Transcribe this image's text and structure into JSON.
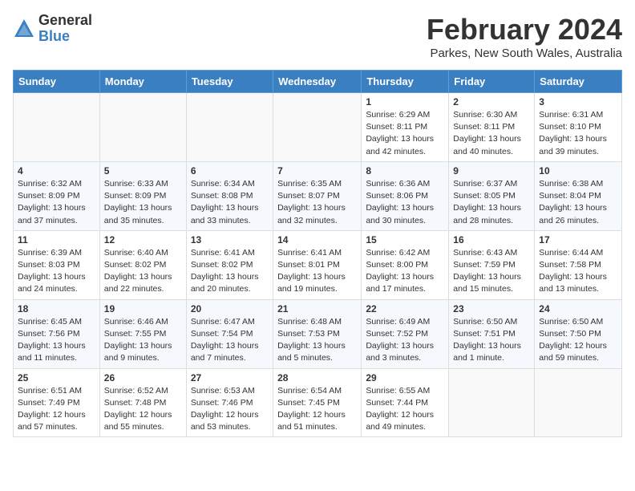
{
  "header": {
    "logo_general": "General",
    "logo_blue": "Blue",
    "month_title": "February 2024",
    "location": "Parkes, New South Wales, Australia"
  },
  "calendar": {
    "headers": [
      "Sunday",
      "Monday",
      "Tuesday",
      "Wednesday",
      "Thursday",
      "Friday",
      "Saturday"
    ],
    "weeks": [
      [
        {
          "day": "",
          "empty": true
        },
        {
          "day": "",
          "empty": true
        },
        {
          "day": "",
          "empty": true
        },
        {
          "day": "",
          "empty": true
        },
        {
          "day": "1",
          "sunrise": "6:29 AM",
          "sunset": "8:11 PM",
          "daylight": "13 hours and 42 minutes."
        },
        {
          "day": "2",
          "sunrise": "6:30 AM",
          "sunset": "8:11 PM",
          "daylight": "13 hours and 40 minutes."
        },
        {
          "day": "3",
          "sunrise": "6:31 AM",
          "sunset": "8:10 PM",
          "daylight": "13 hours and 39 minutes."
        }
      ],
      [
        {
          "day": "4",
          "sunrise": "6:32 AM",
          "sunset": "8:09 PM",
          "daylight": "13 hours and 37 minutes."
        },
        {
          "day": "5",
          "sunrise": "6:33 AM",
          "sunset": "8:09 PM",
          "daylight": "13 hours and 35 minutes."
        },
        {
          "day": "6",
          "sunrise": "6:34 AM",
          "sunset": "8:08 PM",
          "daylight": "13 hours and 33 minutes."
        },
        {
          "day": "7",
          "sunrise": "6:35 AM",
          "sunset": "8:07 PM",
          "daylight": "13 hours and 32 minutes."
        },
        {
          "day": "8",
          "sunrise": "6:36 AM",
          "sunset": "8:06 PM",
          "daylight": "13 hours and 30 minutes."
        },
        {
          "day": "9",
          "sunrise": "6:37 AM",
          "sunset": "8:05 PM",
          "daylight": "13 hours and 28 minutes."
        },
        {
          "day": "10",
          "sunrise": "6:38 AM",
          "sunset": "8:04 PM",
          "daylight": "13 hours and 26 minutes."
        }
      ],
      [
        {
          "day": "11",
          "sunrise": "6:39 AM",
          "sunset": "8:03 PM",
          "daylight": "13 hours and 24 minutes."
        },
        {
          "day": "12",
          "sunrise": "6:40 AM",
          "sunset": "8:02 PM",
          "daylight": "13 hours and 22 minutes."
        },
        {
          "day": "13",
          "sunrise": "6:41 AM",
          "sunset": "8:02 PM",
          "daylight": "13 hours and 20 minutes."
        },
        {
          "day": "14",
          "sunrise": "6:41 AM",
          "sunset": "8:01 PM",
          "daylight": "13 hours and 19 minutes."
        },
        {
          "day": "15",
          "sunrise": "6:42 AM",
          "sunset": "8:00 PM",
          "daylight": "13 hours and 17 minutes."
        },
        {
          "day": "16",
          "sunrise": "6:43 AM",
          "sunset": "7:59 PM",
          "daylight": "13 hours and 15 minutes."
        },
        {
          "day": "17",
          "sunrise": "6:44 AM",
          "sunset": "7:58 PM",
          "daylight": "13 hours and 13 minutes."
        }
      ],
      [
        {
          "day": "18",
          "sunrise": "6:45 AM",
          "sunset": "7:56 PM",
          "daylight": "13 hours and 11 minutes."
        },
        {
          "day": "19",
          "sunrise": "6:46 AM",
          "sunset": "7:55 PM",
          "daylight": "13 hours and 9 minutes."
        },
        {
          "day": "20",
          "sunrise": "6:47 AM",
          "sunset": "7:54 PM",
          "daylight": "13 hours and 7 minutes."
        },
        {
          "day": "21",
          "sunrise": "6:48 AM",
          "sunset": "7:53 PM",
          "daylight": "13 hours and 5 minutes."
        },
        {
          "day": "22",
          "sunrise": "6:49 AM",
          "sunset": "7:52 PM",
          "daylight": "13 hours and 3 minutes."
        },
        {
          "day": "23",
          "sunrise": "6:50 AM",
          "sunset": "7:51 PM",
          "daylight": "13 hours and 1 minute."
        },
        {
          "day": "24",
          "sunrise": "6:50 AM",
          "sunset": "7:50 PM",
          "daylight": "12 hours and 59 minutes."
        }
      ],
      [
        {
          "day": "25",
          "sunrise": "6:51 AM",
          "sunset": "7:49 PM",
          "daylight": "12 hours and 57 minutes."
        },
        {
          "day": "26",
          "sunrise": "6:52 AM",
          "sunset": "7:48 PM",
          "daylight": "12 hours and 55 minutes."
        },
        {
          "day": "27",
          "sunrise": "6:53 AM",
          "sunset": "7:46 PM",
          "daylight": "12 hours and 53 minutes."
        },
        {
          "day": "28",
          "sunrise": "6:54 AM",
          "sunset": "7:45 PM",
          "daylight": "12 hours and 51 minutes."
        },
        {
          "day": "29",
          "sunrise": "6:55 AM",
          "sunset": "7:44 PM",
          "daylight": "12 hours and 49 minutes."
        },
        {
          "day": "",
          "empty": true
        },
        {
          "day": "",
          "empty": true
        }
      ]
    ]
  }
}
